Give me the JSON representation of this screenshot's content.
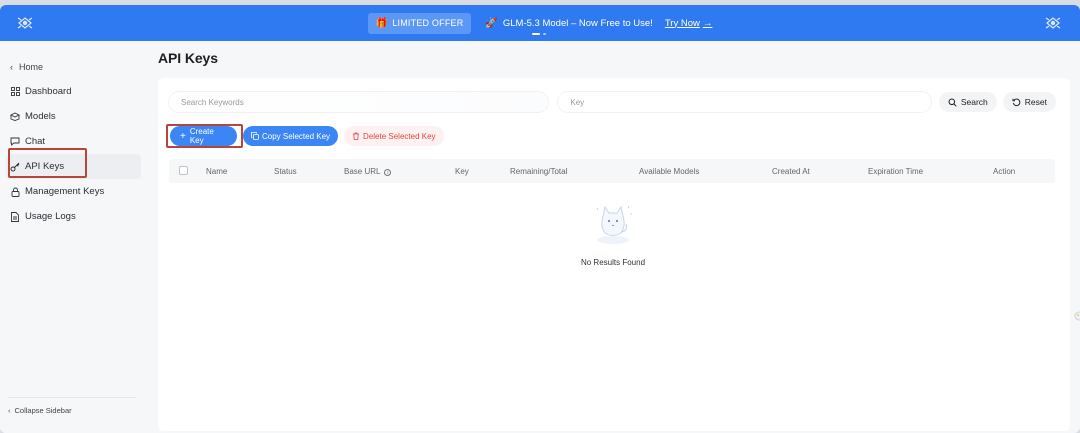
{
  "banner": {
    "offer_label": "LIMITED OFFER",
    "promo_text": "GLM-5.3 Model – Now Free to Use!",
    "try_now": "Try Now",
    "try_arrow": "→",
    "logo_icon": "brand-logo-icon",
    "gift_icon": "gift-icon",
    "rocket_icon": "rocket-icon"
  },
  "sidebar": {
    "home": "Home",
    "items": [
      {
        "label": "Dashboard",
        "icon": "dashboard-icon"
      },
      {
        "label": "Models",
        "icon": "models-icon"
      },
      {
        "label": "Chat",
        "icon": "chat-icon"
      },
      {
        "label": "API Keys",
        "icon": "key-icon",
        "active": true
      },
      {
        "label": "Management Keys",
        "icon": "lock-icon"
      },
      {
        "label": "Usage Logs",
        "icon": "document-icon"
      }
    ],
    "collapse": "Collapse Sidebar"
  },
  "page": {
    "title": "API Keys"
  },
  "filters": {
    "keywords_placeholder": "Search Keywords",
    "key_placeholder": "Key",
    "search_label": "Search",
    "reset_label": "Reset"
  },
  "actions": {
    "create": "Create Key",
    "copy": "Copy Selected Key",
    "delete": "Delete Selected Key"
  },
  "table": {
    "columns": [
      "Name",
      "Status",
      "Base URL",
      "Key",
      "Remaining/Total",
      "Available Models",
      "Created At",
      "Expiration Time",
      "Action"
    ],
    "rows": [],
    "empty_text": "No Results Found"
  },
  "colors": {
    "accent": "#2f7af0",
    "button": "#3b86f4",
    "danger": "#e0473d",
    "highlight": "#b7453a"
  }
}
